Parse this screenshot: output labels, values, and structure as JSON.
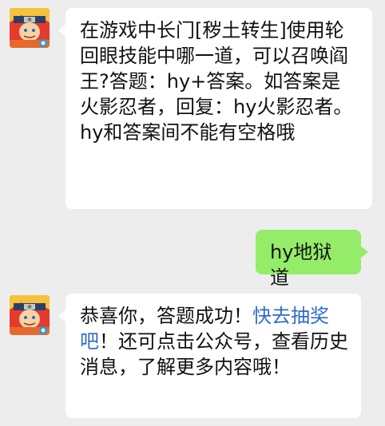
{
  "chat": {
    "messages": [
      {
        "sender": "公众号",
        "avatar_icon": "naruto-avatar-icon",
        "text": "在游戏中长门[秽土转生]使用轮回眼技能中哪一道，可以召唤阎王?答题：hy+答案。如答案是火影忍者，回复：hy火影忍者。hy和答案间不能有空格哦"
      },
      {
        "sender": "me",
        "text": "hy地狱道"
      },
      {
        "sender": "公众号",
        "avatar_icon": "naruto-avatar-icon",
        "text_before": "恭喜你，答题成功！",
        "link_text": "快去抽奖吧",
        "text_after": "！还可点击公众号，查看历史消息，了解更多内容哦！"
      }
    ]
  },
  "colors": {
    "background": "#ededed",
    "incoming_bubble": "#ffffff",
    "outgoing_bubble": "#95ec69",
    "link": "#2f6cc8"
  }
}
